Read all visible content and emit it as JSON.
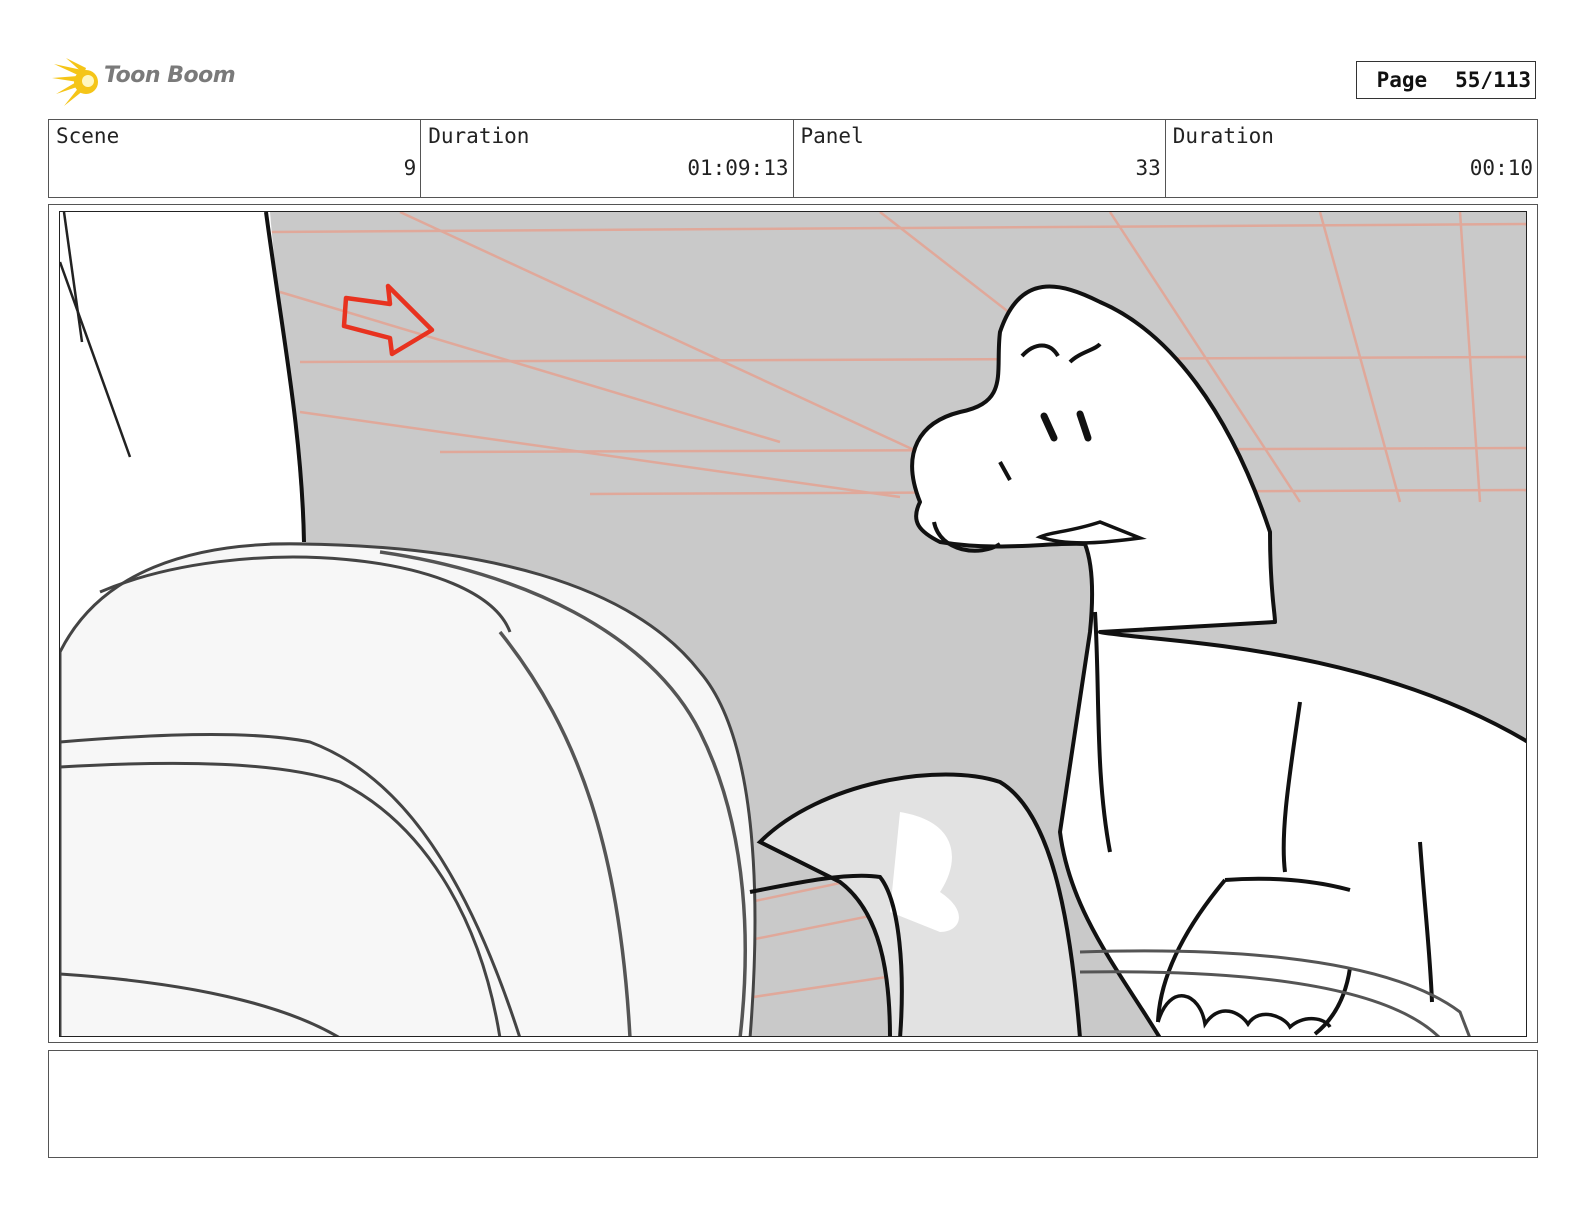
{
  "header": {
    "brand": "Toon Boom",
    "page_label": "Page",
    "page_value": "55/113"
  },
  "info": {
    "scene_label": "Scene",
    "scene_value": "9",
    "scene_duration_label": "Duration",
    "scene_duration_value": "01:09:13",
    "panel_label": "Panel",
    "panel_value": "33",
    "panel_duration_label": "Duration",
    "panel_duration_value": "00:10"
  },
  "colors": {
    "background_gray": "#c9c9c9",
    "guide_lines": "#e0a89a",
    "arrow": "#e8321f",
    "logo_yellow": "#f5c518"
  }
}
